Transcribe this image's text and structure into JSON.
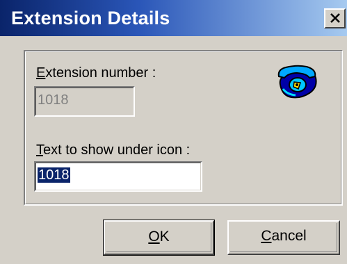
{
  "window": {
    "title": "Extension Details",
    "close_glyph": "X"
  },
  "group": {
    "extension_label_mnemonic": "E",
    "extension_label_rest": "xtension number :",
    "extension_value": "1018",
    "text_label_mnemonic": "T",
    "text_label_rest": "ext to show under icon :",
    "text_value": "1018",
    "icon": "telephone-icon"
  },
  "buttons": {
    "ok_mnemonic": "O",
    "ok_rest": "K",
    "cancel_mnemonic": "C",
    "cancel_rest": "ancel"
  },
  "colors": {
    "title_gradient_start": "#0a246a",
    "title_gradient_end": "#a6caf0",
    "face": "#d4d0c8",
    "selection": "#0a246a"
  }
}
